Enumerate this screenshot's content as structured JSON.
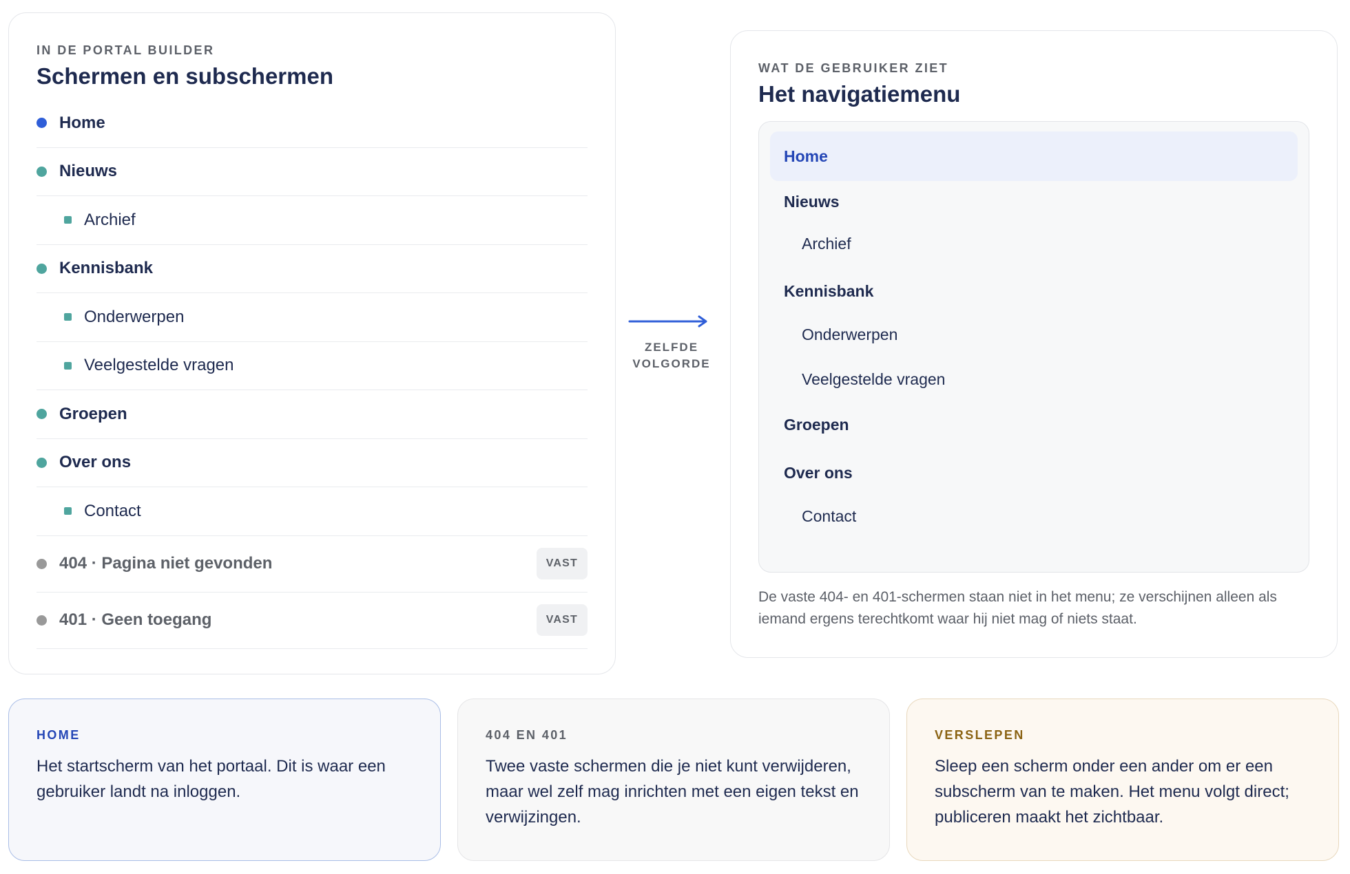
{
  "builder": {
    "eyebrow": "IN DE PORTAL BUILDER",
    "title": "Schermen en subschermen",
    "screens": [
      {
        "label": "Home",
        "level": "top",
        "color": "#2f5ed8"
      },
      {
        "label": "Nieuws",
        "level": "top",
        "color": "#4fa59e"
      },
      {
        "label": "Archief",
        "level": "sub",
        "color": "#4fa59e"
      },
      {
        "label": "Kennisbank",
        "level": "top",
        "color": "#4fa59e"
      },
      {
        "label": "Onderwerpen",
        "level": "sub",
        "color": "#4fa59e"
      },
      {
        "label": "Veelgestelde vragen",
        "level": "sub",
        "color": "#4fa59e"
      },
      {
        "label": "Groepen",
        "level": "top",
        "color": "#4fa59e"
      },
      {
        "label": "Over ons",
        "level": "top",
        "color": "#4fa59e"
      },
      {
        "label": "Contact",
        "level": "sub",
        "color": "#4fa59e"
      }
    ],
    "fixed_screens": [
      {
        "label": "404 · Pagina niet gevonden",
        "badge": "VAST",
        "color": "#999999"
      },
      {
        "label": "401 · Geen toegang",
        "badge": "VAST",
        "color": "#999999"
      }
    ]
  },
  "flow": {
    "line1": "ZELFDE",
    "line2": "VOLGORDE",
    "accent": "#2f5ed8"
  },
  "user_view": {
    "eyebrow": "WAT DE GEBRUIKER ZIET",
    "title": "Het navigatiemenu",
    "menu": [
      {
        "label": "Home",
        "level": "top",
        "active": true
      },
      {
        "label": "Nieuws",
        "level": "top"
      },
      {
        "label": "Archief",
        "level": "sub"
      },
      {
        "label": "Kennisbank",
        "level": "top"
      },
      {
        "label": "Onderwerpen",
        "level": "sub"
      },
      {
        "label": "Veelgestelde vragen",
        "level": "sub"
      },
      {
        "label": "Groepen",
        "level": "top"
      },
      {
        "label": "Over ons",
        "level": "top"
      },
      {
        "label": "Contact",
        "level": "sub"
      }
    ],
    "note": "De vaste 404- en 401-schermen staan niet in het menu; ze verschijnen alleen als iemand ergens terechtkomt waar hij niet mag of niets staat."
  },
  "info_cards": {
    "home": {
      "eyebrow": "HOME",
      "body": "Het startscherm van het portaal. Dit is waar een gebruiker landt na inloggen."
    },
    "errors": {
      "eyebrow": "404 EN 401",
      "body": "Twee vaste schermen die je niet kunt verwijderen, maar wel zelf mag inrichten met een eigen tekst en verwijzingen."
    },
    "drag": {
      "eyebrow": "VERSLEPEN",
      "body": "Sleep een scherm onder een ander om er een subscherm van te maken. Het menu volgt direct; publiceren maakt het zichtbaar."
    }
  }
}
